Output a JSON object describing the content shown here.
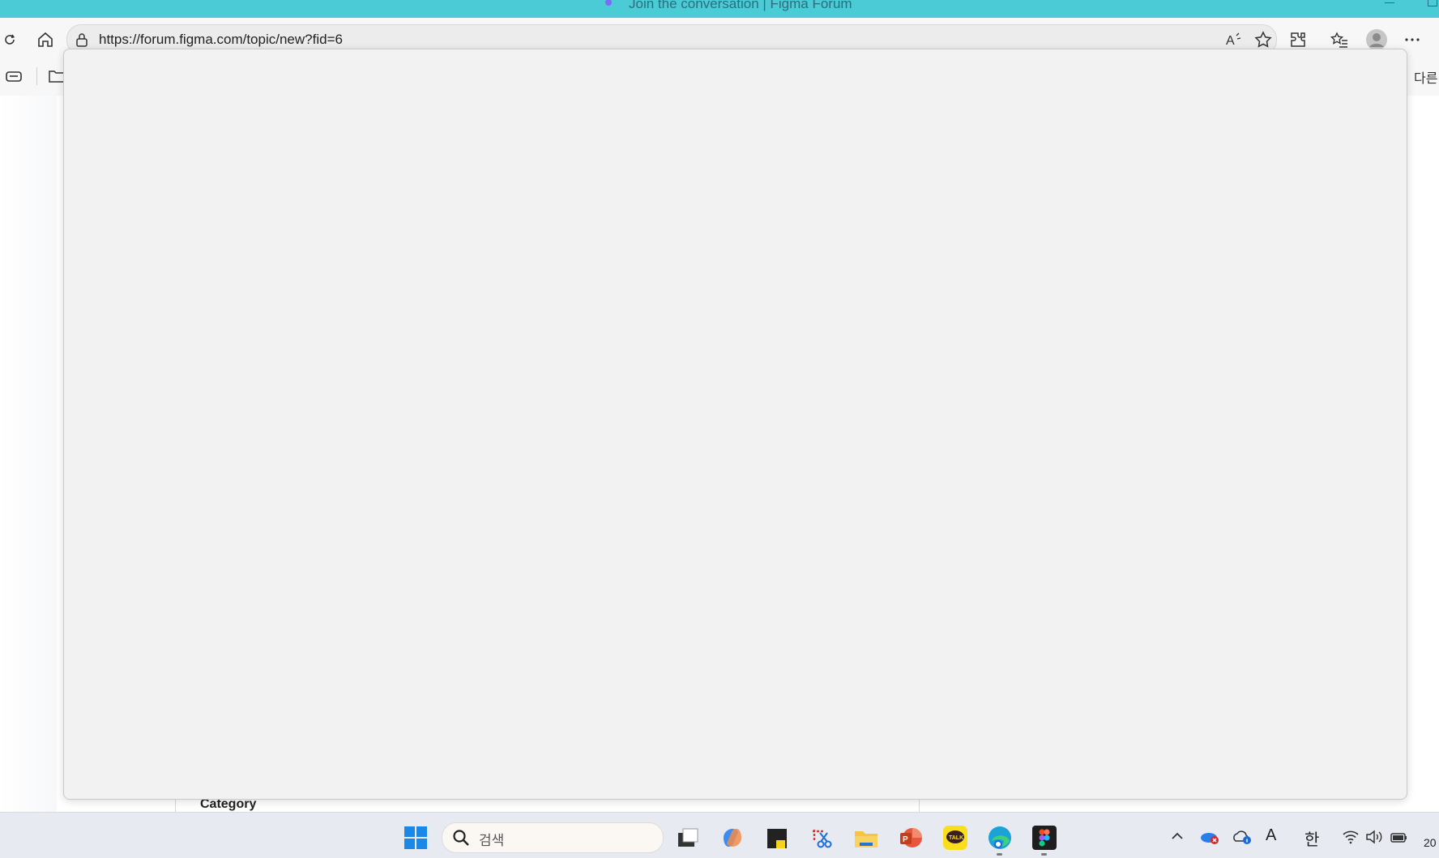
{
  "window": {
    "title": "Join the conversation | Figma Forum",
    "accent_color": "#4acbd5"
  },
  "browser": {
    "url": "https://forum.figma.com/topic/new?fid=6",
    "favorites_overflow_label": "다른",
    "icons": [
      "reload-icon",
      "home-icon",
      "lock-icon",
      "read-aloud-icon",
      "favorite-star-icon",
      "extensions-icon",
      "favorites-icon",
      "profile-icon",
      "more-icon"
    ]
  },
  "page": {
    "category_label": "Category",
    "modal_background": "#f2f2f2"
  },
  "taskbar": {
    "search_placeholder": "검색",
    "ime_mode": "한",
    "font_icon_label": "A",
    "clock_partial": "20",
    "apps": [
      "start-icon",
      "task-view-icon",
      "copilot-icon",
      "sticky-notes-icon",
      "snipping-tool-icon",
      "file-explorer-icon",
      "powerpoint-icon",
      "kakaotalk-icon",
      "edge-icon",
      "figma-icon"
    ]
  }
}
